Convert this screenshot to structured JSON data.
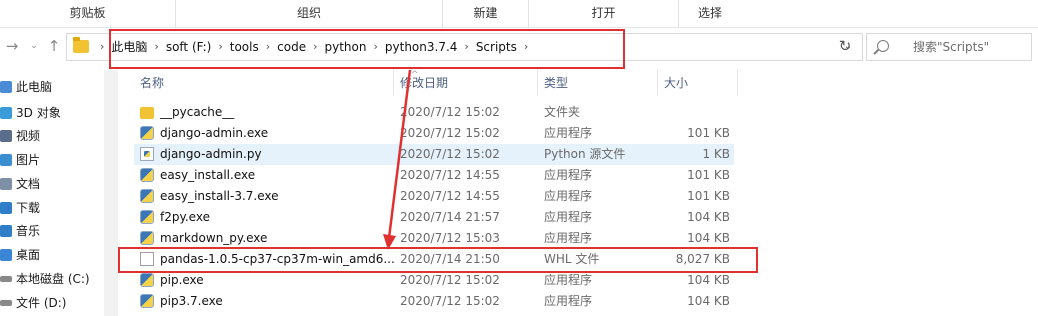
{
  "ribbon": {
    "groups": [
      "剪贴板",
      "组织",
      "新建",
      "打开",
      "选择"
    ]
  },
  "address_bar": {
    "crumbs": [
      "此电脑",
      "soft (F:)",
      "tools",
      "code",
      "python",
      "python3.7.4",
      "Scripts"
    ],
    "search_placeholder": "搜索\"Scripts\""
  },
  "nav_pane": {
    "items": [
      {
        "label": "此电脑",
        "color": "#4a8bd6"
      },
      {
        "label": "3D 对象",
        "color": "#3a9bd9"
      },
      {
        "label": "视频",
        "color": "#5a6e8c"
      },
      {
        "label": "图片",
        "color": "#3b8ed0"
      },
      {
        "label": "文档",
        "color": "#7f8fa6"
      },
      {
        "label": "下载",
        "color": "#2f7ec8"
      },
      {
        "label": "音乐",
        "color": "#2f7ec8"
      },
      {
        "label": "桌面",
        "color": "#3a86d4"
      },
      {
        "label": "本地磁盘 (C:)",
        "color": "#888888"
      },
      {
        "label": "文件 (D:)",
        "color": "#888888"
      }
    ]
  },
  "columns": {
    "name": "名称",
    "date": "修改日期",
    "type": "类型",
    "size": "大小"
  },
  "files": [
    {
      "name": "__pycache__",
      "date": "2020/7/12 15:02",
      "type": "文件夹",
      "size": "",
      "icon": "folder-icon"
    },
    {
      "name": "django-admin.exe",
      "date": "2020/7/12 15:02",
      "type": "应用程序",
      "size": "101 KB",
      "icon": "python-exe-icon"
    },
    {
      "name": "django-admin.py",
      "date": "2020/7/12 15:02",
      "type": "Python 源文件",
      "size": "1 KB",
      "icon": "python-file-icon"
    },
    {
      "name": "easy_install.exe",
      "date": "2020/7/12 14:55",
      "type": "应用程序",
      "size": "101 KB",
      "icon": "python-exe-icon"
    },
    {
      "name": "easy_install-3.7.exe",
      "date": "2020/7/12 14:55",
      "type": "应用程序",
      "size": "101 KB",
      "icon": "python-exe-icon"
    },
    {
      "name": "f2py.exe",
      "date": "2020/7/14 21:57",
      "type": "应用程序",
      "size": "104 KB",
      "icon": "python-exe-icon"
    },
    {
      "name": "markdown_py.exe",
      "date": "2020/7/12 15:03",
      "type": "应用程序",
      "size": "104 KB",
      "icon": "python-exe-icon"
    },
    {
      "name": "pandas-1.0.5-cp37-cp37m-win_amd6...",
      "date": "2020/7/14 21:50",
      "type": "WHL 文件",
      "size": "8,027 KB",
      "icon": "document-icon"
    },
    {
      "name": "pip.exe",
      "date": "2020/7/12 15:02",
      "type": "应用程序",
      "size": "104 KB",
      "icon": "python-exe-icon"
    },
    {
      "name": "pip3.7.exe",
      "date": "2020/7/12 15:02",
      "type": "应用程序",
      "size": "104 KB",
      "icon": "python-exe-icon"
    }
  ],
  "colors": {
    "highlight": "#e03030",
    "selected_row": "#e5f1fb"
  }
}
